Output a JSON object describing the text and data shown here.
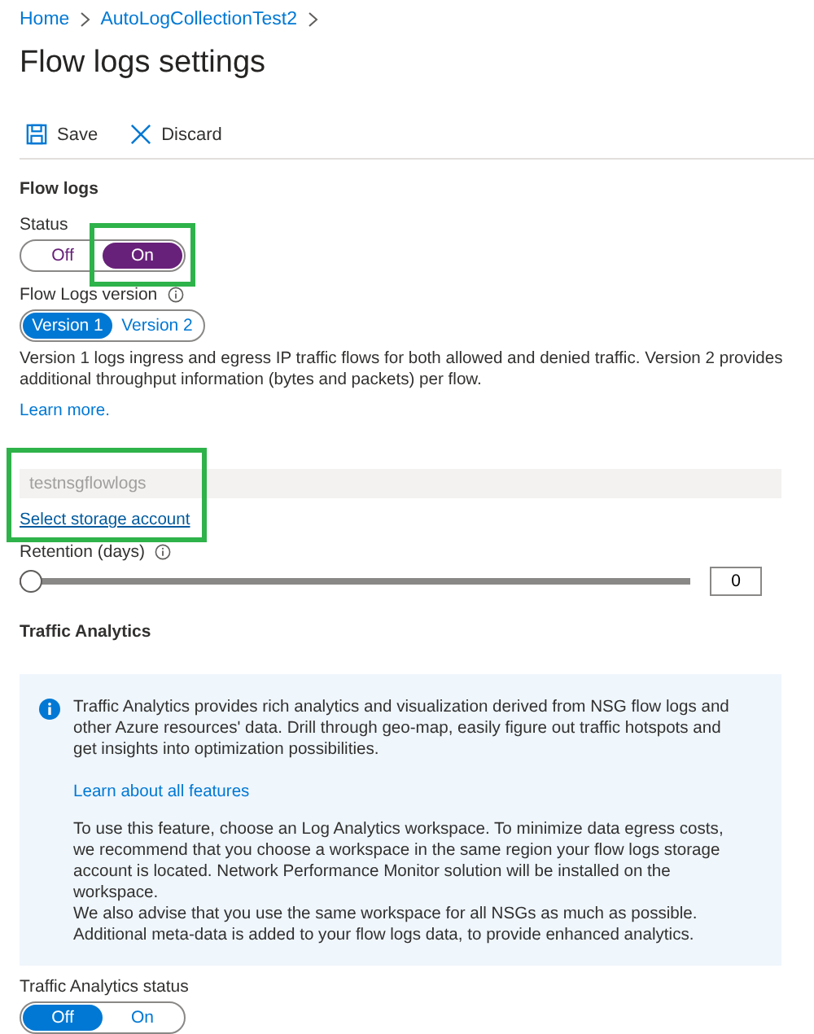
{
  "breadcrumb": [
    {
      "label": "Home"
    },
    {
      "label": "AutoLogCollectionTest2"
    }
  ],
  "title": "Flow logs settings",
  "toolbar": [
    {
      "kind": "save",
      "label": "Save"
    },
    {
      "kind": "discard",
      "label": "Discard"
    }
  ],
  "flow_logs": {
    "heading": "Flow logs",
    "status": {
      "label": "Status",
      "color": "#68217a",
      "options": [
        {
          "label": "Off",
          "selected": false
        },
        {
          "label": "On",
          "selected": true,
          "highlighted": true
        }
      ]
    },
    "version": {
      "label": "Flow Logs version",
      "color": "#0078d4",
      "options": [
        {
          "label": "Version 1",
          "selected": true
        },
        {
          "label": "Version 2",
          "selected": false
        }
      ]
    },
    "description": "Version 1 logs ingress and egress IP traffic flows for both allowed and denied traffic. Version 2 provides additional throughput information (bytes and packets) per flow.",
    "learn_more": "Learn more.",
    "storage": {
      "value": "testnsgflowlogs",
      "link": "Select storage account",
      "highlighted": true
    },
    "retention": {
      "label": "Retention (days)",
      "level": 0,
      "value": "0"
    }
  },
  "traffic_analytics": {
    "heading": "Traffic Analytics",
    "info": {
      "intro": "Traffic Analytics provides rich analytics and visualization derived from NSG flow logs and other Azure resources' data. Drill through geo-map, easily figure out traffic hotspots and get insights into optimization possibilities.",
      "link": "Learn about all features",
      "paragraphs": [
        "To use this feature, choose an Log Analytics workspace. To minimize data egress costs, we recommend that you choose a workspace in the same region your flow logs storage account is located. Network Performance Monitor solution will be installed on the workspace.",
        "We also advise that you use the same workspace for all NSGs as much as possible. Additional meta-data is added to your flow logs data, to provide enhanced analytics."
      ]
    },
    "status": {
      "label": "Traffic Analytics status",
      "color": "#0078d4",
      "options": [
        {
          "label": "Off",
          "selected": true
        },
        {
          "label": "On",
          "selected": false
        }
      ]
    }
  }
}
